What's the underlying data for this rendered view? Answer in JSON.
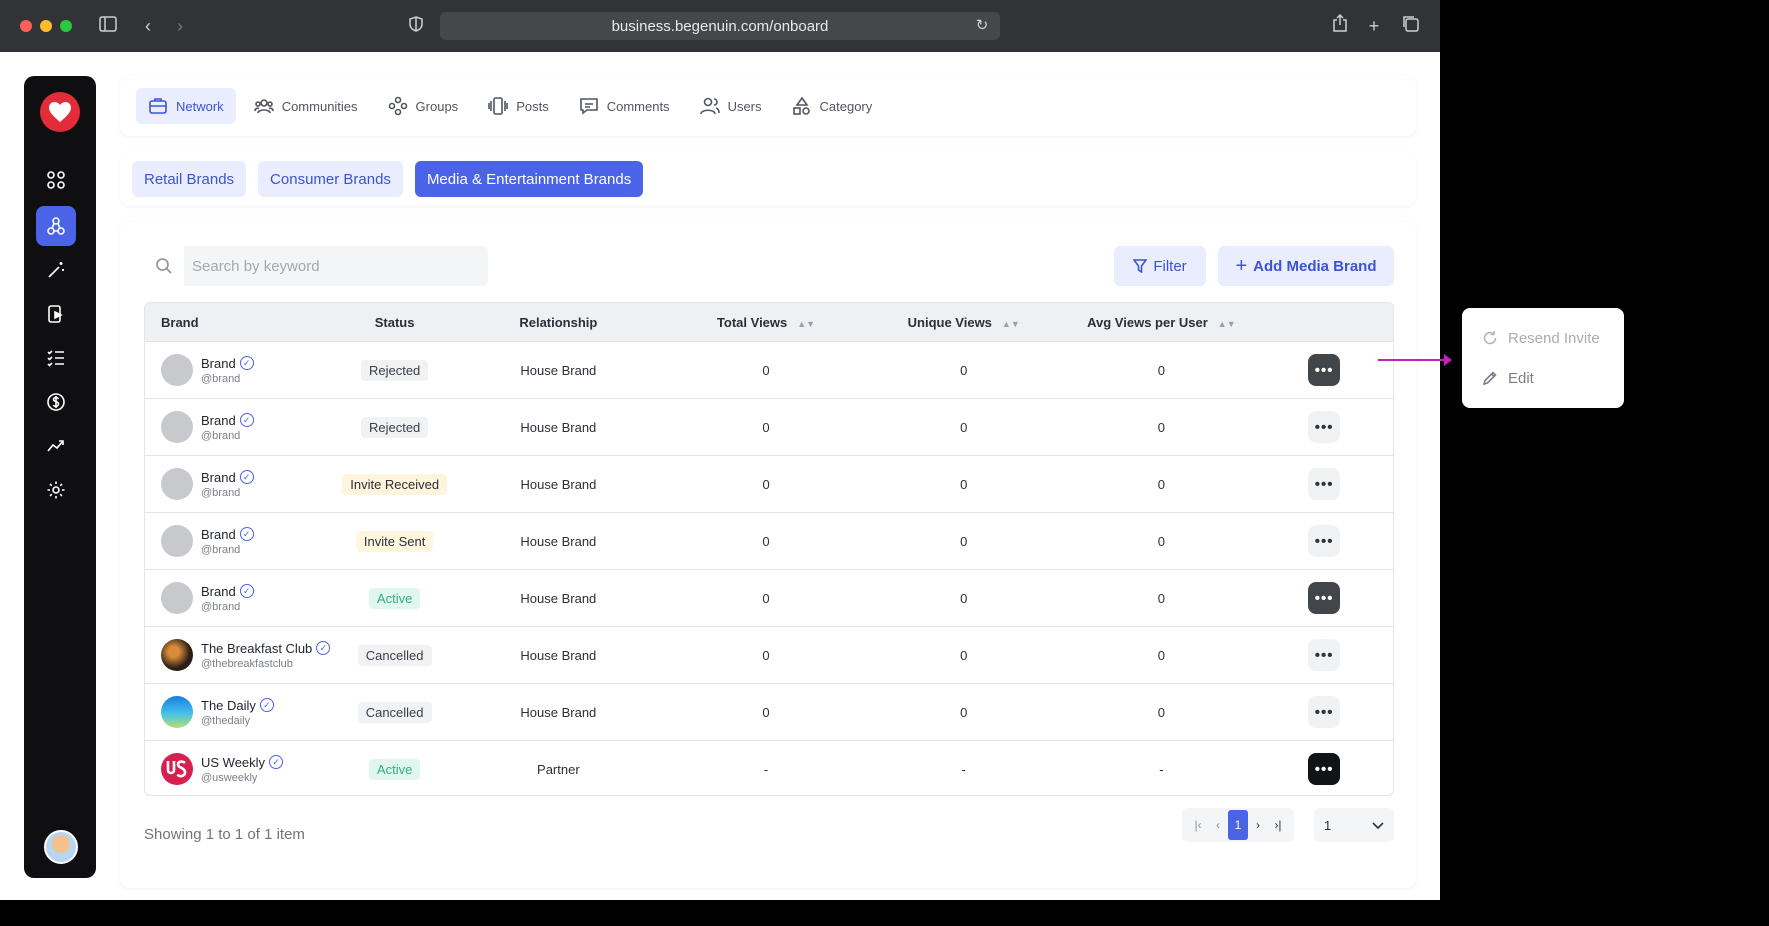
{
  "browser": {
    "url": "business.begenuin.com/onboard"
  },
  "topnav": {
    "tabs": [
      {
        "label": "Network",
        "icon": "briefcase-icon"
      },
      {
        "label": "Communities",
        "icon": "people-icon"
      },
      {
        "label": "Groups",
        "icon": "groups-icon"
      },
      {
        "label": "Posts",
        "icon": "posts-icon"
      },
      {
        "label": "Comments",
        "icon": "comment-icon"
      },
      {
        "label": "Users",
        "icon": "users-icon"
      },
      {
        "label": "Category",
        "icon": "category-icon"
      }
    ]
  },
  "brand_tabs": [
    "Retail Brands",
    "Consumer Brands",
    "Media & Entertainment Brands"
  ],
  "search": {
    "placeholder": "Search by keyword"
  },
  "buttons": {
    "filter": "Filter",
    "add": "Add Media Brand"
  },
  "table": {
    "headers": {
      "brand": "Brand",
      "status": "Status",
      "relationship": "Relationship",
      "total_views": "Total Views",
      "unique_views": "Unique Views",
      "avg_views": "Avg Views per User"
    },
    "rows": [
      {
        "name": "Brand",
        "handle": "@brand",
        "status": "Rejected",
        "relationship": "House Brand",
        "total": "0",
        "unique": "0",
        "avg": "0"
      },
      {
        "name": "Brand",
        "handle": "@brand",
        "status": "Rejected",
        "relationship": "House Brand",
        "total": "0",
        "unique": "0",
        "avg": "0"
      },
      {
        "name": "Brand",
        "handle": "@brand",
        "status": "Invite Received",
        "relationship": "House Brand",
        "total": "0",
        "unique": "0",
        "avg": "0"
      },
      {
        "name": "Brand",
        "handle": "@brand",
        "status": "Invite Sent",
        "relationship": "House Brand",
        "total": "0",
        "unique": "0",
        "avg": "0"
      },
      {
        "name": "Brand",
        "handle": "@brand",
        "status": "Active",
        "relationship": "House Brand",
        "total": "0",
        "unique": "0",
        "avg": "0"
      },
      {
        "name": "The Breakfast Club",
        "handle": "@thebreakfastclub",
        "status": "Cancelled",
        "relationship": "House Brand",
        "total": "0",
        "unique": "0",
        "avg": "0"
      },
      {
        "name": "The Daily",
        "handle": "@thedaily",
        "status": "Cancelled",
        "relationship": "House Brand",
        "total": "0",
        "unique": "0",
        "avg": "0"
      },
      {
        "name": "US Weekly",
        "handle": "@usweekly",
        "status": "Active",
        "relationship": "Partner",
        "total": "-",
        "unique": "-",
        "avg": "-"
      }
    ]
  },
  "footer": {
    "showing": "Showing 1 to 1 of 1 item",
    "current_page": "1",
    "page_select": "1"
  },
  "popover": {
    "items": [
      "Resend Invite",
      "Edit"
    ]
  },
  "colors": {
    "accent": "#4a63e7",
    "connector": "#c61fbf"
  }
}
